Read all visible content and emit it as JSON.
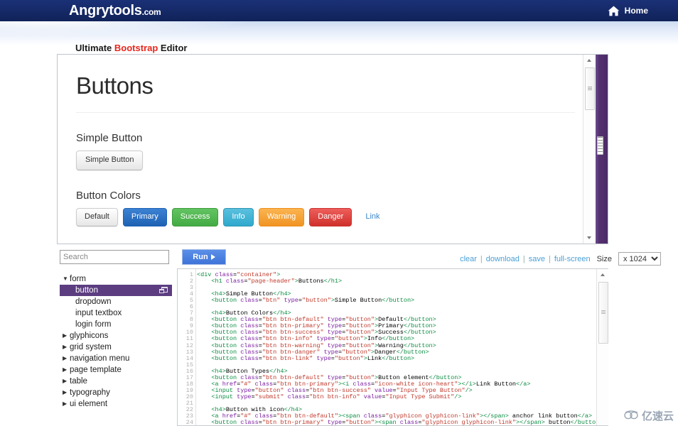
{
  "navbar": {
    "brand_name": "Angrytools",
    "brand_tld": ".com",
    "home_label": "Home",
    "home_icon": "home-icon",
    "bg_color": "#15296b"
  },
  "page": {
    "title_prefix": "Ultimate ",
    "title_highlight": "Bootstrap",
    "title_suffix": " Editor",
    "highlight_color": "#e8251c"
  },
  "preview": {
    "heading": "Buttons",
    "sections": [
      {
        "label": "Simple Button",
        "buttons": [
          {
            "label": "Simple Button",
            "variant": "default"
          }
        ]
      },
      {
        "label": "Button Colors",
        "buttons": [
          {
            "label": "Default",
            "variant": "default",
            "color": "#e6e6e6"
          },
          {
            "label": "Primary",
            "variant": "primary",
            "color": "#1f62b4"
          },
          {
            "label": "Success",
            "variant": "success",
            "color": "#43ab43"
          },
          {
            "label": "Info",
            "variant": "info",
            "color": "#2fa9cd"
          },
          {
            "label": "Warning",
            "variant": "warning",
            "color": "#f09423"
          },
          {
            "label": "Danger",
            "variant": "danger",
            "color": "#cf302c"
          },
          {
            "label": "Link",
            "variant": "link",
            "color": "#3a87c8"
          }
        ]
      }
    ]
  },
  "toolbar": {
    "search_placeholder": "Search",
    "search_value": "",
    "run_label": "Run",
    "run_icon": "play-icon",
    "links": [
      "clear",
      "download",
      "save",
      "full-screen"
    ],
    "separator": "|",
    "size_label": "Size",
    "size_value": "x 1024",
    "size_options": [
      "x 1024"
    ]
  },
  "tree": {
    "groups": [
      {
        "label": "form",
        "expanded": true,
        "caret": "▼",
        "children": [
          {
            "label": "button",
            "selected": true,
            "icon": "window-restore-icon"
          },
          {
            "label": "dropdown",
            "selected": false
          },
          {
            "label": "input textbox",
            "selected": false
          },
          {
            "label": "login form",
            "selected": false
          }
        ]
      },
      {
        "label": "glyphicons",
        "expanded": false,
        "caret": "▶",
        "children": []
      },
      {
        "label": "grid system",
        "expanded": false,
        "caret": "▶",
        "children": []
      },
      {
        "label": "navigation menu",
        "expanded": false,
        "caret": "▶",
        "children": []
      },
      {
        "label": "page template",
        "expanded": false,
        "caret": "▶",
        "children": []
      },
      {
        "label": "table",
        "expanded": false,
        "caret": "▶",
        "children": []
      },
      {
        "label": "typography",
        "expanded": false,
        "caret": "▶",
        "children": []
      },
      {
        "label": "ui element",
        "expanded": false,
        "caret": "▶",
        "children": []
      }
    ],
    "selected_bg": "#5b3d80"
  },
  "editor": {
    "first_line_number": 1,
    "last_line_number": 24,
    "lines": [
      "<div class=\"container\">",
      "    <h1 class=\"page-header\">Buttons</h1>",
      "",
      "    <h4>Simple Button</h4>",
      "    <button class=\"btn\" type=\"button\">Simple Button</button>",
      "",
      "    <h4>Button Colors</h4>",
      "    <button class=\"btn btn-default\" type=\"button\">Default</button>",
      "    <button class=\"btn btn-primary\" type=\"button\">Primary</button>",
      "    <button class=\"btn btn-success\" type=\"button\">Success</button>",
      "    <button class=\"btn btn-info\" type=\"button\">Info</button>",
      "    <button class=\"btn btn-warning\" type=\"button\">Warning</button>",
      "    <button class=\"btn btn-danger\" type=\"button\">Danger</button>",
      "    <button class=\"btn btn-link\" type=\"button\">Link</button>",
      "",
      "    <h4>Button Types</h4>",
      "    <button class=\"btn btn-default\" type=\"button\">Button element</button>",
      "    <a href=\"#\" class=\"btn btn-primary\"><i class=\"icon-white icon-heart\"></i>Link Button</a>",
      "    <input type=\"button\" class=\"btn btn-success\" value=\"Input Type Button\"/>",
      "    <input type=\"submit\" class=\"btn btn-info\" value=\"Input Type Submit\"/>",
      "",
      "    <h4>Button with icon</h4>",
      "    <a href=\"#\" class=\"btn btn-default\"><span class=\"glyphicon glyphicon-link\"></span> anchor link button</a>",
      "    <button class=\"btn btn-primary\" type=\"button\"><span class=\"glyphicon glyphicon-link\"></span> button</button>"
    ]
  },
  "watermark": {
    "text": "亿速云",
    "icon": "cloud-icon"
  }
}
